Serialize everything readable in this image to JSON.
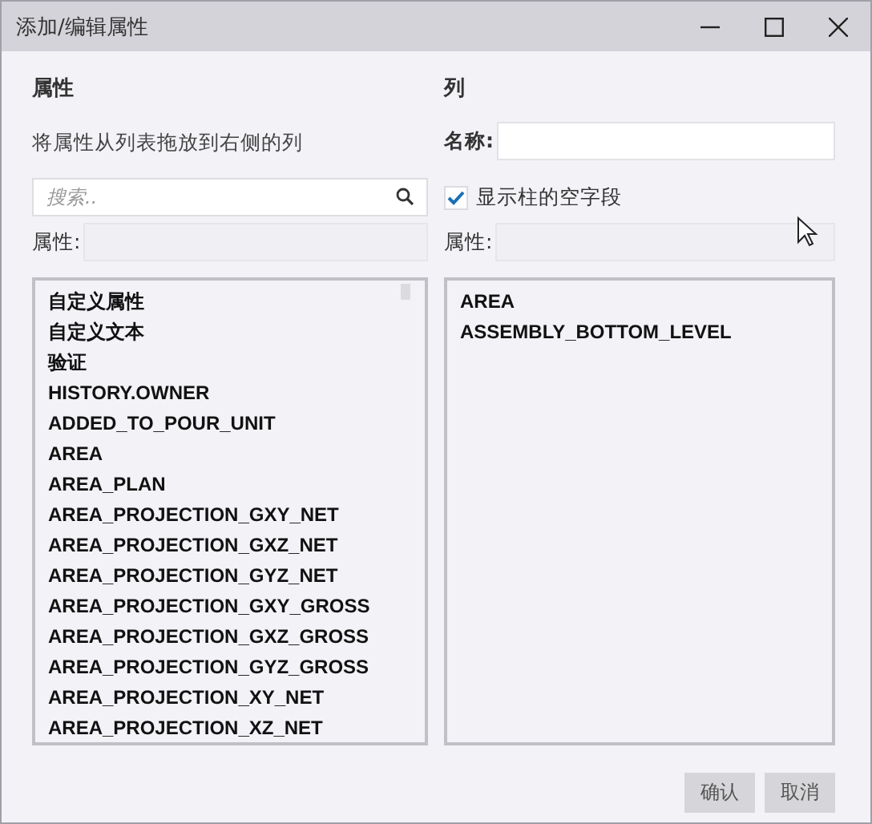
{
  "window": {
    "title": "添加/编辑属性"
  },
  "left": {
    "heading": "属性",
    "hint": "将属性从列表拖放到右侧的列",
    "search": {
      "placeholder": "搜索.."
    },
    "filter_label": "属性:",
    "items": [
      "自定义属性",
      "自定义文本",
      "验证",
      "HISTORY.OWNER",
      "ADDED_TO_POUR_UNIT",
      "AREA",
      "AREA_PLAN",
      "AREA_PROJECTION_GXY_NET",
      "AREA_PROJECTION_GXZ_NET",
      "AREA_PROJECTION_GYZ_NET",
      "AREA_PROJECTION_GXY_GROSS",
      "AREA_PROJECTION_GXZ_GROSS",
      "AREA_PROJECTION_GYZ_GROSS",
      "AREA_PROJECTION_XY_NET",
      "AREA_PROJECTION_XZ_NET"
    ]
  },
  "right": {
    "heading": "列",
    "name_label": "名称:",
    "show_empty": {
      "label": "显示柱的空字段",
      "checked": true
    },
    "filter_label": "属性:",
    "items": [
      "AREA",
      "ASSEMBLY_BOTTOM_LEVEL"
    ]
  },
  "buttons": [
    "确认",
    "取消"
  ]
}
